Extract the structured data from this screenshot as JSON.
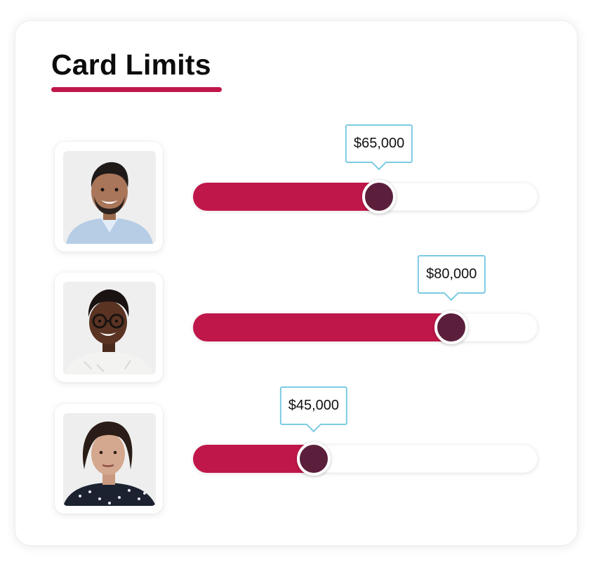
{
  "title": "Card Limits",
  "colors": {
    "accent": "#c0174a",
    "thumb": "#5b1f3c",
    "tooltip_border": "#7ccbe2",
    "track": "#ffffff"
  },
  "limits": [
    {
      "person": "smiling man with beard in light blue shirt",
      "amount_label": "$65,000",
      "fill_fraction": 0.54
    },
    {
      "person": "smiling woman with short hair and glasses",
      "amount_label": "$80,000",
      "fill_fraction": 0.75
    },
    {
      "person": "woman with dark hair in patterned blouse",
      "amount_label": "$45,000",
      "fill_fraction": 0.35
    }
  ]
}
